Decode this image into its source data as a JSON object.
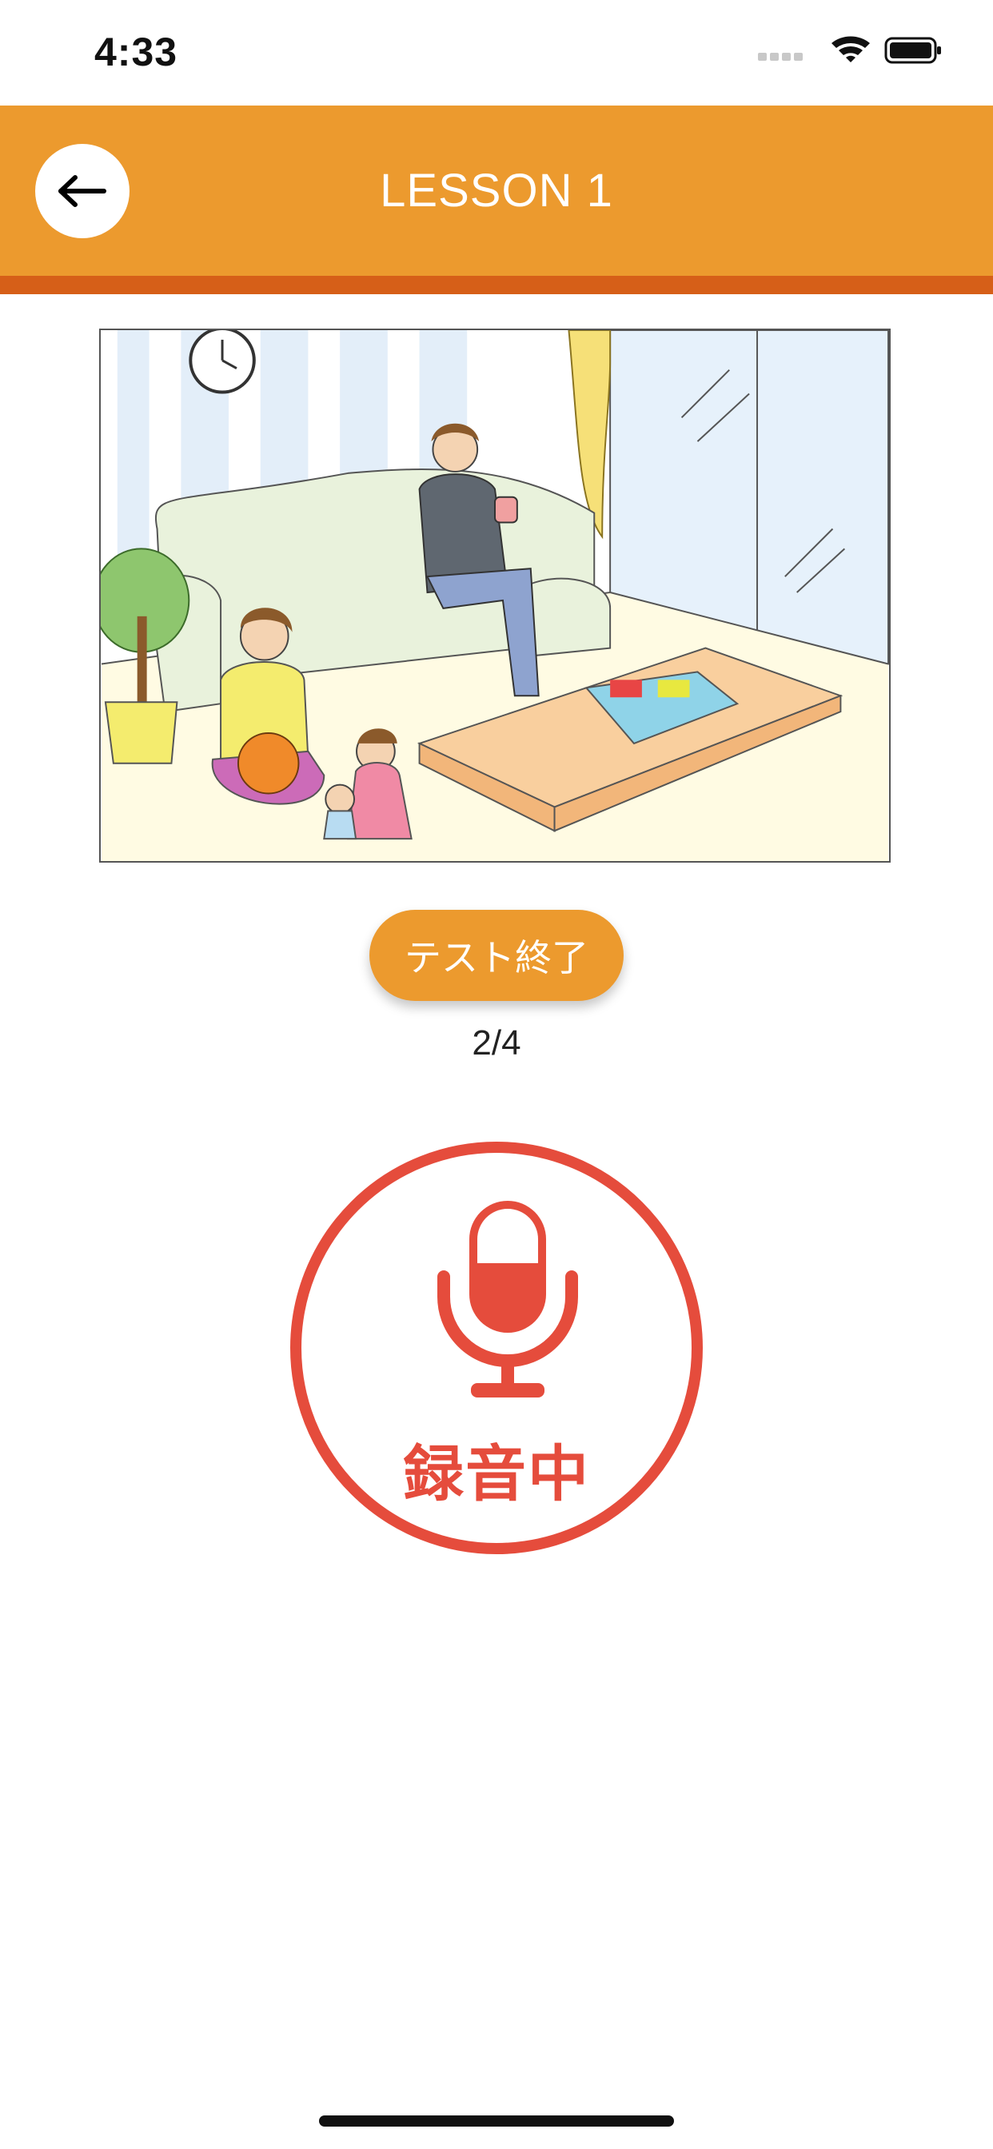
{
  "status_bar": {
    "time": "4:33",
    "icons": [
      "signal-icon",
      "wifi-icon",
      "battery-icon"
    ]
  },
  "header": {
    "title": "LESSON 1",
    "back_icon": "arrow-left-icon",
    "color": "#ec9a2e",
    "stripe_color": "#d65f18"
  },
  "controls": {
    "end_test_label": "テスト終了",
    "progress": "2/4",
    "record_label": "録音中",
    "record_color": "#e54c3c"
  }
}
